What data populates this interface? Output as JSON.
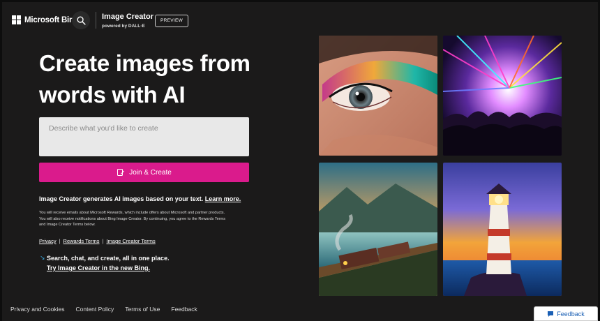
{
  "header": {
    "brand": "Microsoft Bing",
    "app_title": "Image Creator",
    "powered_by": "powered by DALL·E",
    "preview_badge": "PREVIEW"
  },
  "hero": {
    "headline": "Create images from words with AI",
    "prompt_placeholder": "Describe what you'd like to create",
    "join_button": "Join & Create",
    "info_text": "Image Creator generates AI images based on your text.",
    "learn_more": "Learn more.",
    "fine_print": "You will receive emails about Microsoft Rewards, which include offers about Microsoft and partner products. You will also receive notifications about Bing Image Creator. By continuing, you agree to the Rewards Terms and Image Creator Terms below.",
    "terms_links": [
      "Privacy",
      "Rewards Terms",
      "Image Creator Terms"
    ],
    "new_bing_line": "Search, chat, and create, all in one place.",
    "new_bing_link": "Try Image Creator in the new Bing."
  },
  "gallery": [
    "eye-makeup-image",
    "concert-lasers-image",
    "train-lake-painting-image",
    "lighthouse-painting-image"
  ],
  "footer": {
    "links": [
      "Privacy and Cookies",
      "Content Policy",
      "Terms of Use",
      "Feedback"
    ],
    "feedback_button": "Feedback"
  },
  "colors": {
    "background": "#1b1a1a",
    "accent": "#da1b8c",
    "input_bg": "#e8e8e8",
    "feedback_text": "#1a5fb4"
  }
}
